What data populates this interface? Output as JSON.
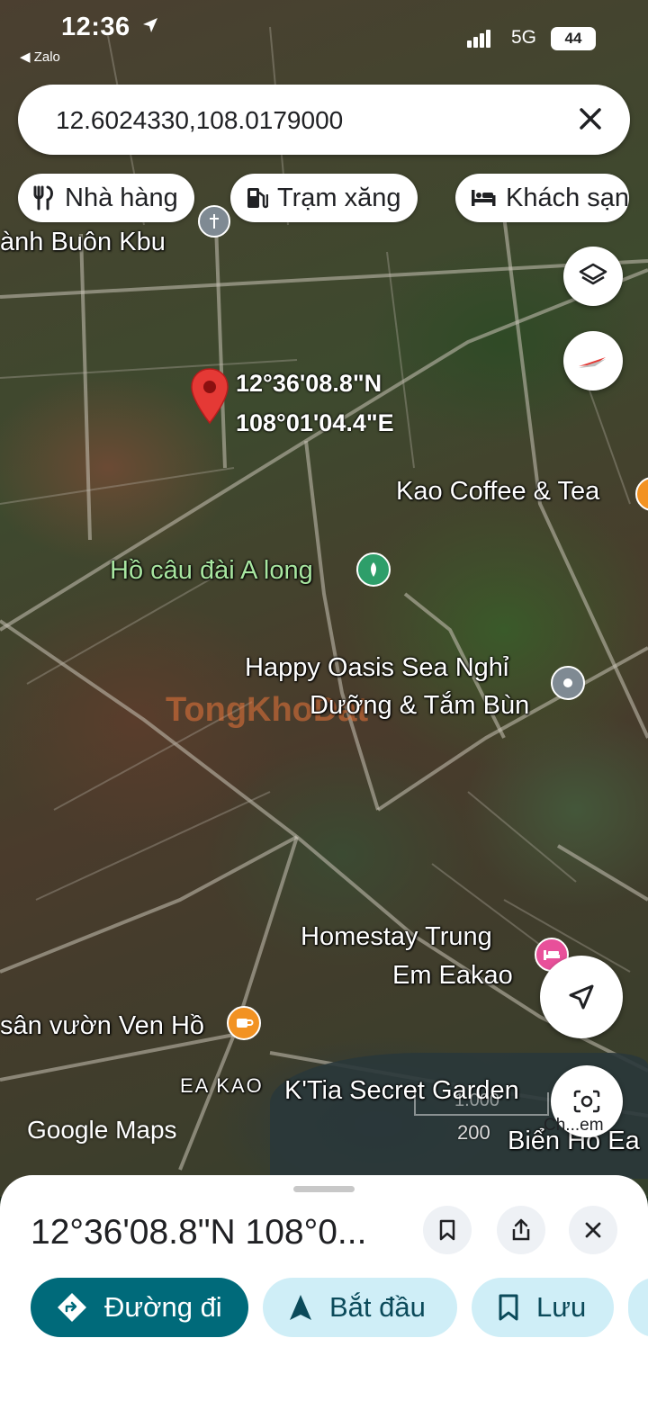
{
  "status_bar": {
    "time": "12:36",
    "back_app": "◀ Zalo",
    "network": "5G",
    "battery": "44"
  },
  "search": {
    "query": "12.6024330,108.0179000"
  },
  "chips": [
    {
      "label": "Nhà hàng",
      "icon": "restaurant-icon"
    },
    {
      "label": "Trạm xăng",
      "icon": "gas-station-icon"
    },
    {
      "label": "Khách sạn",
      "icon": "hotel-icon"
    }
  ],
  "map": {
    "pin_lat": "12°36'08.8\"N",
    "pin_lng": "108°01'04.4\"E",
    "labels": {
      "buon_kbu": "ành Buôn Kbu",
      "kao_coffee": "Kao Coffee & Tea",
      "ho_cau": "Hồ câu đài A long",
      "happy_oasis_1": "Happy Oasis Sea Nghỉ",
      "happy_oasis_2": "Dưỡng & Tắm Bùn",
      "homestay_1": "Homestay Trung",
      "homestay_2": "Em Eakao",
      "san_vuon": "sân vườn Ven Hồ",
      "ea_kao": "EA KAO",
      "ktia": "K'Tia Secret Garden",
      "bien_ho": "Biển Hồ Ea",
      "watermark": "TongKhoDat"
    },
    "google_logo": "Google Maps",
    "scale_label": "200",
    "scale_label_top": "1.000",
    "camera_label": "Ch...em",
    "colors": {
      "pin": "#e53935",
      "poi_green": "#2e9e6a",
      "poi_orange": "#f29222",
      "poi_pink": "#e8509a",
      "poi_grey": "#7f8a93"
    }
  },
  "sheet": {
    "title": "12°36'08.8\"N 108°0...",
    "actions": {
      "directions": "Đường đi",
      "start": "Bắt đầu",
      "save": "Lưu"
    },
    "colors": {
      "primary": "#006a7a",
      "secondary": "#cfeef7"
    }
  }
}
